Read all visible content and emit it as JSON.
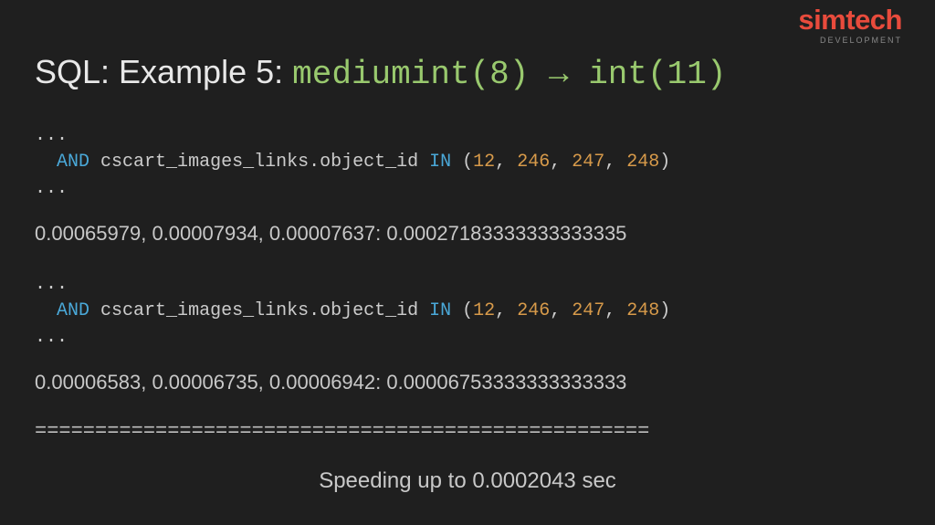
{
  "logo": {
    "main": "simtech",
    "sub": "DEVELOPMENT"
  },
  "title": {
    "prefix": "SQL: Example 5: ",
    "code": "mediumint(8)  →  int(11)"
  },
  "block1": {
    "ellipsis1": "...",
    "indent": "  ",
    "kw_and": "AND",
    "sp1": " ",
    "ident": "cscart_images_links.object_id",
    "sp2": " ",
    "kw_in": "IN",
    "sp3": " (",
    "n1": "12",
    "c1": ", ",
    "n2": "246",
    "c2": ", ",
    "n3": "247",
    "c3": ", ",
    "n4": "248",
    "close": ")",
    "ellipsis2": "..."
  },
  "timings1": "0.00065979, 0.00007934, 0.00007637: 0.00027183333333333335",
  "block2": {
    "ellipsis1": "...",
    "indent": "  ",
    "kw_and": "AND",
    "sp1": " ",
    "ident": "cscart_images_links.object_id",
    "sp2": " ",
    "kw_in": "IN",
    "sp3": " (",
    "n1": "12",
    "c1": ", ",
    "n2": "246",
    "c2": ", ",
    "n3": "247",
    "c3": ", ",
    "n4": "248",
    "close": ")",
    "ellipsis2": "..."
  },
  "timings2": "0.00006583, 0.00006735, 0.00006942: 0.00006753333333333333",
  "divider": "===================================================",
  "footer": "Speeding up to 0.0002043 sec"
}
